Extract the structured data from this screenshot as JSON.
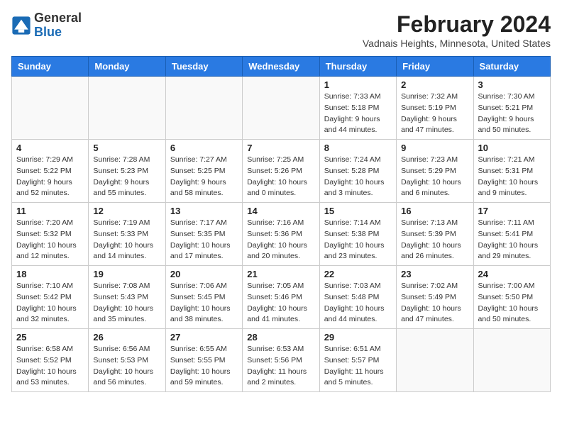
{
  "header": {
    "logo_general": "General",
    "logo_blue": "Blue",
    "title": "February 2024",
    "subtitle": "Vadnais Heights, Minnesota, United States"
  },
  "weekdays": [
    "Sunday",
    "Monday",
    "Tuesday",
    "Wednesday",
    "Thursday",
    "Friday",
    "Saturday"
  ],
  "weeks": [
    [
      {
        "day": "",
        "info": ""
      },
      {
        "day": "",
        "info": ""
      },
      {
        "day": "",
        "info": ""
      },
      {
        "day": "",
        "info": ""
      },
      {
        "day": "1",
        "info": "Sunrise: 7:33 AM\nSunset: 5:18 PM\nDaylight: 9 hours\nand 44 minutes."
      },
      {
        "day": "2",
        "info": "Sunrise: 7:32 AM\nSunset: 5:19 PM\nDaylight: 9 hours\nand 47 minutes."
      },
      {
        "day": "3",
        "info": "Sunrise: 7:30 AM\nSunset: 5:21 PM\nDaylight: 9 hours\nand 50 minutes."
      }
    ],
    [
      {
        "day": "4",
        "info": "Sunrise: 7:29 AM\nSunset: 5:22 PM\nDaylight: 9 hours\nand 52 minutes."
      },
      {
        "day": "5",
        "info": "Sunrise: 7:28 AM\nSunset: 5:23 PM\nDaylight: 9 hours\nand 55 minutes."
      },
      {
        "day": "6",
        "info": "Sunrise: 7:27 AM\nSunset: 5:25 PM\nDaylight: 9 hours\nand 58 minutes."
      },
      {
        "day": "7",
        "info": "Sunrise: 7:25 AM\nSunset: 5:26 PM\nDaylight: 10 hours\nand 0 minutes."
      },
      {
        "day": "8",
        "info": "Sunrise: 7:24 AM\nSunset: 5:28 PM\nDaylight: 10 hours\nand 3 minutes."
      },
      {
        "day": "9",
        "info": "Sunrise: 7:23 AM\nSunset: 5:29 PM\nDaylight: 10 hours\nand 6 minutes."
      },
      {
        "day": "10",
        "info": "Sunrise: 7:21 AM\nSunset: 5:31 PM\nDaylight: 10 hours\nand 9 minutes."
      }
    ],
    [
      {
        "day": "11",
        "info": "Sunrise: 7:20 AM\nSunset: 5:32 PM\nDaylight: 10 hours\nand 12 minutes."
      },
      {
        "day": "12",
        "info": "Sunrise: 7:19 AM\nSunset: 5:33 PM\nDaylight: 10 hours\nand 14 minutes."
      },
      {
        "day": "13",
        "info": "Sunrise: 7:17 AM\nSunset: 5:35 PM\nDaylight: 10 hours\nand 17 minutes."
      },
      {
        "day": "14",
        "info": "Sunrise: 7:16 AM\nSunset: 5:36 PM\nDaylight: 10 hours\nand 20 minutes."
      },
      {
        "day": "15",
        "info": "Sunrise: 7:14 AM\nSunset: 5:38 PM\nDaylight: 10 hours\nand 23 minutes."
      },
      {
        "day": "16",
        "info": "Sunrise: 7:13 AM\nSunset: 5:39 PM\nDaylight: 10 hours\nand 26 minutes."
      },
      {
        "day": "17",
        "info": "Sunrise: 7:11 AM\nSunset: 5:41 PM\nDaylight: 10 hours\nand 29 minutes."
      }
    ],
    [
      {
        "day": "18",
        "info": "Sunrise: 7:10 AM\nSunset: 5:42 PM\nDaylight: 10 hours\nand 32 minutes."
      },
      {
        "day": "19",
        "info": "Sunrise: 7:08 AM\nSunset: 5:43 PM\nDaylight: 10 hours\nand 35 minutes."
      },
      {
        "day": "20",
        "info": "Sunrise: 7:06 AM\nSunset: 5:45 PM\nDaylight: 10 hours\nand 38 minutes."
      },
      {
        "day": "21",
        "info": "Sunrise: 7:05 AM\nSunset: 5:46 PM\nDaylight: 10 hours\nand 41 minutes."
      },
      {
        "day": "22",
        "info": "Sunrise: 7:03 AM\nSunset: 5:48 PM\nDaylight: 10 hours\nand 44 minutes."
      },
      {
        "day": "23",
        "info": "Sunrise: 7:02 AM\nSunset: 5:49 PM\nDaylight: 10 hours\nand 47 minutes."
      },
      {
        "day": "24",
        "info": "Sunrise: 7:00 AM\nSunset: 5:50 PM\nDaylight: 10 hours\nand 50 minutes."
      }
    ],
    [
      {
        "day": "25",
        "info": "Sunrise: 6:58 AM\nSunset: 5:52 PM\nDaylight: 10 hours\nand 53 minutes."
      },
      {
        "day": "26",
        "info": "Sunrise: 6:56 AM\nSunset: 5:53 PM\nDaylight: 10 hours\nand 56 minutes."
      },
      {
        "day": "27",
        "info": "Sunrise: 6:55 AM\nSunset: 5:55 PM\nDaylight: 10 hours\nand 59 minutes."
      },
      {
        "day": "28",
        "info": "Sunrise: 6:53 AM\nSunset: 5:56 PM\nDaylight: 11 hours\nand 2 minutes."
      },
      {
        "day": "29",
        "info": "Sunrise: 6:51 AM\nSunset: 5:57 PM\nDaylight: 11 hours\nand 5 minutes."
      },
      {
        "day": "",
        "info": ""
      },
      {
        "day": "",
        "info": ""
      }
    ]
  ]
}
